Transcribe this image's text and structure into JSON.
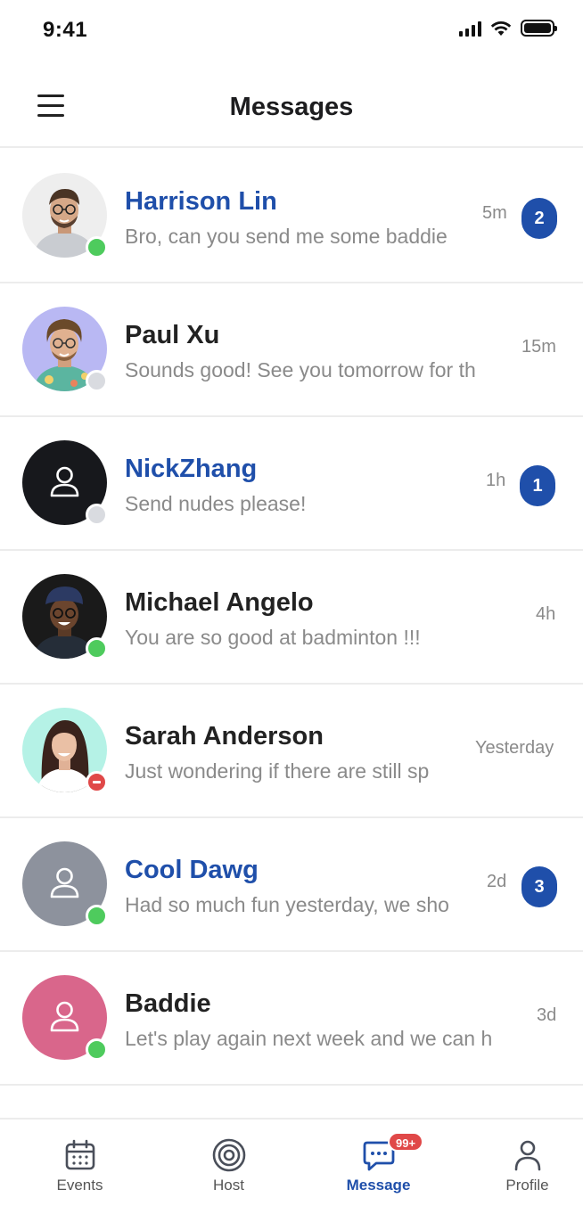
{
  "status_bar": {
    "time": "9:41"
  },
  "header": {
    "title": "Messages"
  },
  "theme": {
    "accent": "#1f4faa",
    "online": "#4ecb5d",
    "offline": "#d9dbe0",
    "busy": "#e04848",
    "badge": "#e04848"
  },
  "conversations": [
    {
      "name": "Harrison Lin",
      "preview": "Bro, can you send me some baddie",
      "time": "5m",
      "unread_count": "2",
      "unread": true,
      "presence": "online"
    },
    {
      "name": "Paul Xu",
      "preview": "Sounds good! See you tomorrow for th",
      "time": "15m",
      "unread_count": "",
      "unread": false,
      "presence": "offline"
    },
    {
      "name": "NickZhang",
      "preview": "Send nudes please!",
      "time": "1h",
      "unread_count": "1",
      "unread": true,
      "presence": "offline"
    },
    {
      "name": "Michael Angelo",
      "preview": "You are so good at badminton !!!",
      "time": "4h",
      "unread_count": "",
      "unread": false,
      "presence": "online"
    },
    {
      "name": "Sarah Anderson",
      "preview": "Just wondering if there are still sp",
      "time": "Yesterday",
      "unread_count": "",
      "unread": false,
      "presence": "busy"
    },
    {
      "name": "Cool Dawg",
      "preview": "Had so much fun yesterday, we sho",
      "time": "2d",
      "unread_count": "3",
      "unread": true,
      "presence": "online"
    },
    {
      "name": "Baddie",
      "preview": "Let's play again next week and we can h",
      "time": "3d",
      "unread_count": "",
      "unread": false,
      "presence": "online"
    }
  ],
  "tab_bar": {
    "tabs": [
      {
        "label": "Events",
        "icon": "calendar-icon"
      },
      {
        "label": "Host",
        "icon": "target-icon"
      },
      {
        "label": "Message",
        "icon": "chat-icon",
        "badge": "99+"
      },
      {
        "label": "Profile",
        "icon": "user-icon"
      }
    ]
  }
}
